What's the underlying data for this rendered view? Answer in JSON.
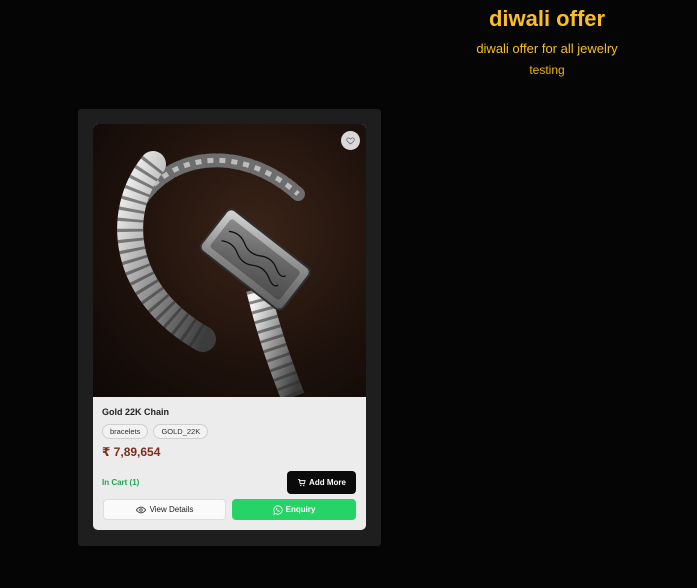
{
  "offer": {
    "title": "diwali offer",
    "subtitle": "diwali offer for all jewelry",
    "note": "testing"
  },
  "product": {
    "name": "Gold 22K Chain",
    "tags": [
      "bracelets",
      "GOLD_22K"
    ],
    "price": "₹ 7,89,654",
    "cart_status": "In Cart (1)",
    "add_more_label": "Add More",
    "view_details_label": "View Details",
    "enquiry_label": "Enquiry",
    "image_alt": "Silver chain bracelet with engraved ID plate",
    "icons": {
      "wishlist": "heart-icon",
      "cart": "cart-icon",
      "view": "eye-icon",
      "enquiry": "whatsapp-icon"
    }
  },
  "colors": {
    "accent": "#fbbf24",
    "whatsapp_green": "#25d366",
    "in_cart_green": "#22a653",
    "price": "#7a2e1e"
  }
}
